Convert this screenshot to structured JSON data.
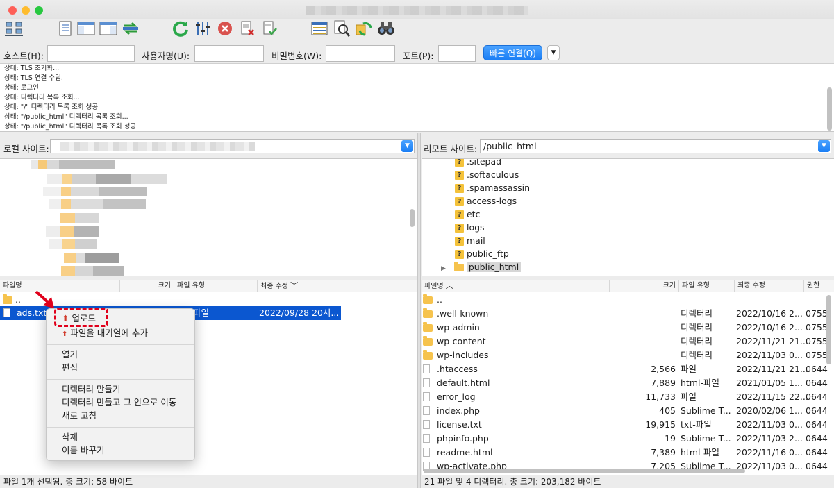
{
  "toolbar": {
    "icons": [
      "site-manager-icon",
      "toggle-message-log-icon",
      "toggle-local-tree-icon",
      "toggle-remote-tree-icon",
      "toggle-transfer-queue-icon",
      "refresh-icon",
      "filter-icon",
      "cancel-icon",
      "disconnect-icon",
      "reconnect-icon",
      "directory-compare-icon",
      "search-files-icon",
      "synchronized-browsing-icon",
      "binoculars-icon"
    ]
  },
  "quickconnect": {
    "host_label": "호스트(H):",
    "user_label": "사용자명(U):",
    "pass_label": "비밀번호(W):",
    "port_label": "포트(P):",
    "connect_label": "빠른 연결(Q)",
    "dropdown": "▼"
  },
  "log": [
    "상태:  TLS 초기화...",
    "상태:  TLS 연결 수립.",
    "상태:  로그인",
    "상태:  디렉터리 목록 조회...",
    "상태:  \"/\" 디렉터리 목록 조회 성공",
    "상태:  \"/public_html\" 디렉터리 목록 조회...",
    "상태:  \"/public_html\" 디렉터리 목록 조회 성공"
  ],
  "local": {
    "site_label": "로컬 사이트:",
    "headers": {
      "name": "파일명",
      "size": "크기",
      "type": "파일 유형",
      "modified": "최종 수정"
    },
    "rows": [
      {
        "name": "..",
        "type": "",
        "modified": ""
      },
      {
        "name": "ads.txt",
        "type": "파일",
        "modified": "2022/09/28 20시..."
      }
    ],
    "status": "파일 1개 선택됨. 총 크기: 58 바이트"
  },
  "remote": {
    "site_label": "리모트 사이트:",
    "site_path": "/public_html",
    "tree": [
      ".sitepad",
      ".softaculous",
      ".spamassassin",
      "access-logs",
      "etc",
      "logs",
      "mail",
      "public_ftp",
      "public_html"
    ],
    "headers": {
      "name": "파일명",
      "size": "크기",
      "type": "파일 유형",
      "modified": "최종 수정",
      "perm": "권한"
    },
    "rows": [
      {
        "name": "..",
        "size": "",
        "type": "",
        "modified": "",
        "perm": "",
        "kind": "folder"
      },
      {
        "name": ".well-known",
        "size": "",
        "type": "디렉터리",
        "modified": "2022/10/16 2...",
        "perm": "0755",
        "kind": "folder"
      },
      {
        "name": "wp-admin",
        "size": "",
        "type": "디렉터리",
        "modified": "2022/10/16 2...",
        "perm": "0755",
        "kind": "folder"
      },
      {
        "name": "wp-content",
        "size": "",
        "type": "디렉터리",
        "modified": "2022/11/21 21...",
        "perm": "0755",
        "kind": "folder"
      },
      {
        "name": "wp-includes",
        "size": "",
        "type": "디렉터리",
        "modified": "2022/11/03 0...",
        "perm": "0755",
        "kind": "folder"
      },
      {
        "name": ".htaccess",
        "size": "2,566",
        "type": "파일",
        "modified": "2022/11/21 21...",
        "perm": "0644",
        "kind": "file"
      },
      {
        "name": "default.html",
        "size": "7,889",
        "type": "html-파일",
        "modified": "2021/01/05 1...",
        "perm": "0644",
        "kind": "file"
      },
      {
        "name": "error_log",
        "size": "11,733",
        "type": "파일",
        "modified": "2022/11/15 22...",
        "perm": "0644",
        "kind": "file"
      },
      {
        "name": "index.php",
        "size": "405",
        "type": "Sublime T...",
        "modified": "2020/02/06 1...",
        "perm": "0644",
        "kind": "file"
      },
      {
        "name": "license.txt",
        "size": "19,915",
        "type": "txt-파일",
        "modified": "2022/11/03 0...",
        "perm": "0644",
        "kind": "file"
      },
      {
        "name": "phpinfo.php",
        "size": "19",
        "type": "Sublime T...",
        "modified": "2022/11/03 2...",
        "perm": "0644",
        "kind": "file"
      },
      {
        "name": "readme.html",
        "size": "7,389",
        "type": "html-파일",
        "modified": "2022/11/16 0...",
        "perm": "0644",
        "kind": "file"
      },
      {
        "name": "wp-activate.php",
        "size": "7,205",
        "type": "Sublime T...",
        "modified": "2022/11/03 0...",
        "perm": "0644",
        "kind": "file"
      }
    ],
    "status": "21 파일 및 4 디렉터리. 총 크기: 203,182 바이트"
  },
  "context_menu": {
    "upload": "업로드",
    "add_queue": "파일을 대기열에 추가",
    "open": "열기",
    "edit": "편집",
    "mkdir": "디렉터리 만들기",
    "mkdir_enter": "디렉터리 만들고 그 안으로 이동",
    "refresh": "새로 고침",
    "delete": "삭제",
    "rename": "이름 바꾸기"
  },
  "colors": {
    "selection": "#0b57d0",
    "accent": "#1a7ef5",
    "annotation": "#e0001b"
  }
}
